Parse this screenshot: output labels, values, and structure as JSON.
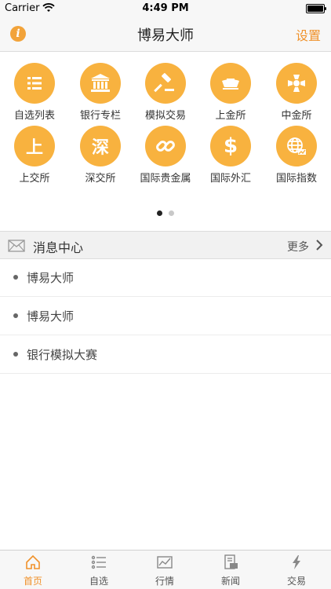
{
  "status_bar": {
    "carrier": "Carrier",
    "time": "4:49 PM"
  },
  "nav": {
    "title": "博易大师",
    "settings_label": "设置",
    "info_glyph": "i"
  },
  "grid": {
    "items": [
      {
        "label": "自选列表",
        "icon": "list-icon"
      },
      {
        "label": "银行专栏",
        "icon": "bank-icon"
      },
      {
        "label": "模拟交易",
        "icon": "gavel-icon"
      },
      {
        "label": "上金所",
        "icon": "gold-ingot-icon"
      },
      {
        "label": "中金所",
        "icon": "cross-emblem-icon"
      },
      {
        "label": "上交所",
        "icon": "shang-char-icon",
        "glyph": "上"
      },
      {
        "label": "深交所",
        "icon": "shen-char-icon",
        "glyph": "深"
      },
      {
        "label": "国际贵金属",
        "icon": "chain-link-icon"
      },
      {
        "label": "国际外汇",
        "icon": "dollar-icon",
        "glyph": "$"
      },
      {
        "label": "国际指数",
        "icon": "globe-icon"
      }
    ]
  },
  "pager": {
    "pages": 2,
    "active": 0
  },
  "message_center": {
    "title": "消息中心",
    "more_label": "更多",
    "items": [
      "博易大师",
      "博易大师",
      "银行模拟大赛"
    ]
  },
  "tab_bar": {
    "tabs": [
      {
        "label": "首页",
        "icon": "home-icon",
        "active": true
      },
      {
        "label": "自选",
        "icon": "list-icon",
        "active": false
      },
      {
        "label": "行情",
        "icon": "chart-icon",
        "active": false
      },
      {
        "label": "新闻",
        "icon": "news-icon",
        "active": false
      },
      {
        "label": "交易",
        "icon": "lightning-icon",
        "active": false
      }
    ]
  },
  "colors": {
    "accent": "#f0922b",
    "icon_bg": "#f8b23f"
  }
}
